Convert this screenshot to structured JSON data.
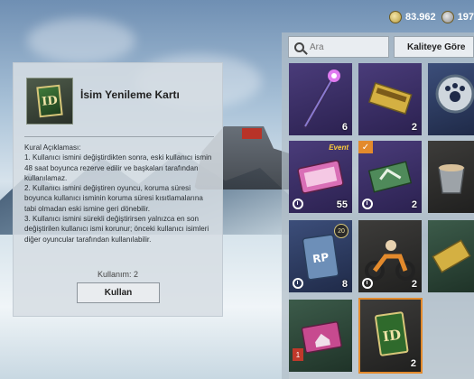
{
  "currency": [
    {
      "icon": "coin-icon",
      "value": "83.962"
    },
    {
      "icon": "uc-icon",
      "value": "197"
    }
  ],
  "search": {
    "placeholder": "Ara"
  },
  "sort": {
    "label": "Kaliteye Göre"
  },
  "item_detail": {
    "title": "İsim Yenileme Kartı",
    "rules_heading": "Kural Açıklaması:",
    "rules": [
      "1. Kullanıcı ismini değiştirdikten sonra, eski kullanıcı ismin 48 saat boyunca rezerve edilir ve başkaları tarafından kullanılamaz.",
      "2. Kullanıcı ismini değiştiren oyuncu, koruma süresi boyunca kullanıcı isminin koruma süresi kısıtlamalarına tabi olmadan eski ismine geri dönebilir.",
      "3. Kullanıcı ismini sürekli değiştirirsen yalnızca en son değiştirilen kullanıcı ismi korunur; önceki kullanıcı isimleri diğer oyuncular tarafından kullanılabilir."
    ],
    "usage": "Kullanım: 2",
    "use_button": "Kullan"
  },
  "inventory": [
    {
      "name": "wand",
      "qty": "6"
    },
    {
      "name": "gold-ticket",
      "qty": "2"
    },
    {
      "name": "paw-emblem",
      "qty": ""
    },
    {
      "name": "event-ticket",
      "qty": "55",
      "tag": "Event"
    },
    {
      "name": "green-voucher",
      "qty": "2"
    },
    {
      "name": "bucket",
      "qty": ""
    },
    {
      "name": "rp-card",
      "qty": "8",
      "level": "20"
    },
    {
      "name": "motorbike",
      "qty": "2"
    },
    {
      "name": "gold-ticket-2",
      "qty": ""
    },
    {
      "name": "house-card",
      "qty": "",
      "badge": "1"
    },
    {
      "name": "id-card",
      "qty": "2"
    }
  ],
  "colors": {
    "selected_border": "#e38a2c",
    "event_text": "#ffcf3a"
  }
}
